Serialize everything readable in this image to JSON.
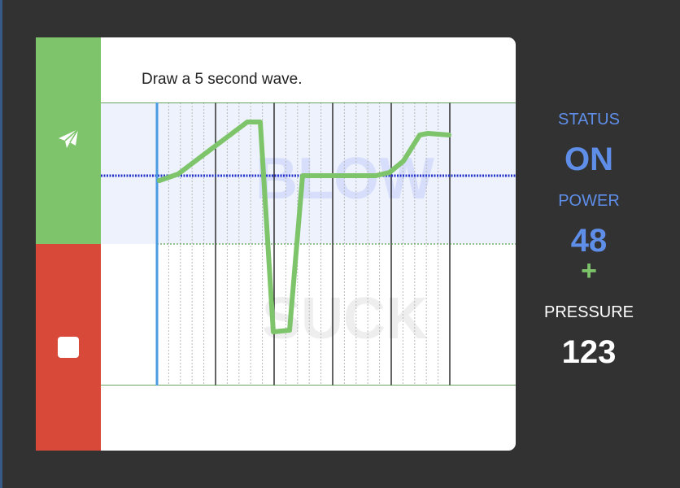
{
  "instruction": "Draw a 5 second wave.",
  "buttons": {
    "send_icon": "paper-plane-icon",
    "stop_icon": "stop-icon"
  },
  "graph": {
    "blow_label": "BLOW",
    "suck_label": "SUCK",
    "wave_color": "#7dc46b",
    "baseline_color": "#2233cc",
    "cursor_color": "#4a9be0"
  },
  "status": {
    "status_label": "STATUS",
    "status_value": "ON",
    "power_label": "POWER",
    "power_value": "48",
    "plus_label": "+",
    "pressure_label": "PRESSURE",
    "pressure_value": "123"
  },
  "colors": {
    "send_green": "#7dc46b",
    "stop_red": "#d9493a",
    "accent_blue": "#5e8ee8",
    "background": "#323232"
  }
}
